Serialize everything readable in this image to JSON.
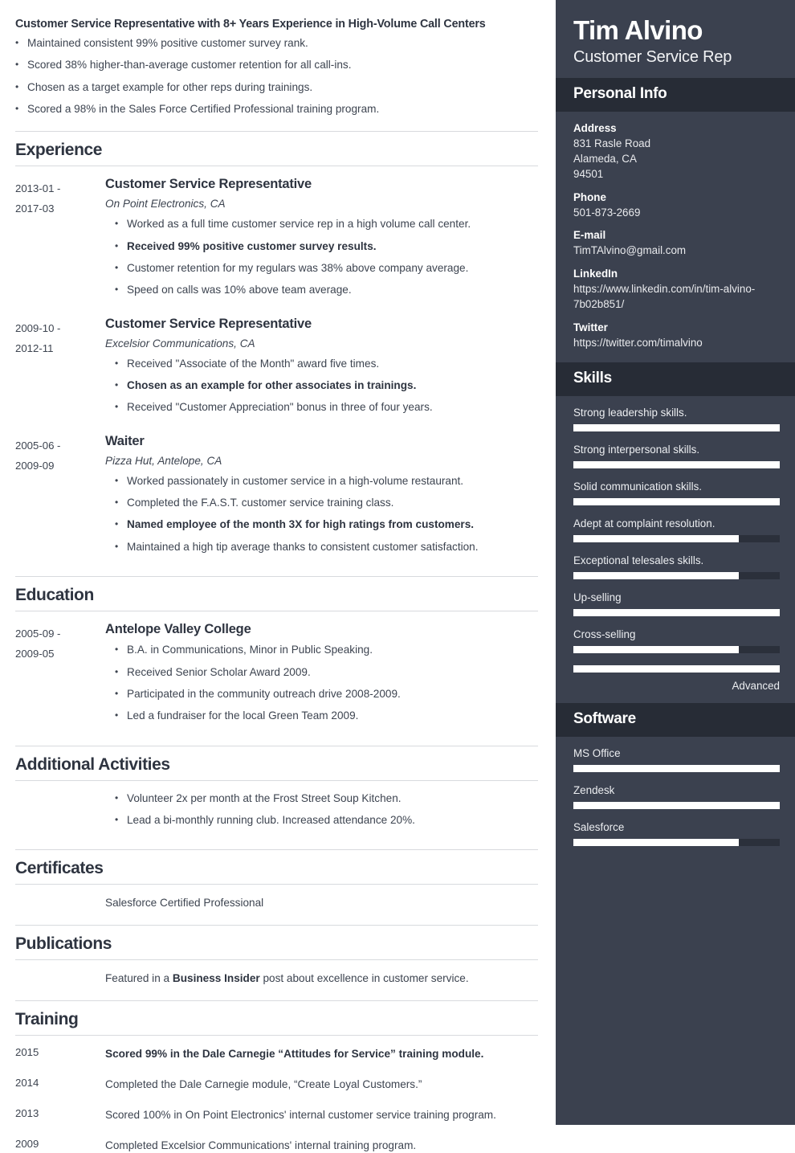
{
  "summary": {
    "title": "Customer Service Representative with 8+ Years Experience in High-Volume Call Centers",
    "bullets": [
      "Maintained consistent 99% positive customer survey rank.",
      "Scored 38% higher-than-average customer retention for all call-ins.",
      "Chosen as a target example for other reps during trainings.",
      "Scored a 98% in the Sales Force Certified Professional training program."
    ]
  },
  "sections": {
    "experience": "Experience",
    "education": "Education",
    "activities": "Additional Activities",
    "certificates": "Certificates",
    "publications": "Publications",
    "training": "Training"
  },
  "experience": [
    {
      "date_from": "2013-01 -",
      "date_to": "2017-03",
      "title": "Customer Service Representative",
      "company": "On Point Electronics, CA",
      "bullets": [
        {
          "text": "Worked as a full time customer service rep in a high volume call center.",
          "bold": false
        },
        {
          "text": "Received 99% positive customer survey results.",
          "bold": true
        },
        {
          "text": "Customer retention for my regulars was 38% above company average.",
          "bold": false
        },
        {
          "text": "Speed on calls was 10% above team average.",
          "bold": false
        }
      ]
    },
    {
      "date_from": "2009-10 -",
      "date_to": "2012-11",
      "title": "Customer Service Representative",
      "company": "Excelsior Communications, CA",
      "bullets": [
        {
          "text": "Received \"Associate of the Month\" award five times.",
          "bold": false
        },
        {
          "text": "Chosen as an example for other associates in trainings.",
          "bold": true
        },
        {
          "text": "Received \"Customer Appreciation\" bonus in three of four years.",
          "bold": false
        }
      ]
    },
    {
      "date_from": "2005-06 -",
      "date_to": "2009-09",
      "title": "Waiter",
      "company": "Pizza Hut, Antelope, CA",
      "bullets": [
        {
          "text": "Worked passionately in customer service in a high-volume restaurant.",
          "bold": false
        },
        {
          "text": "Completed the F.A.S.T. customer service training class.",
          "bold": false
        },
        {
          "text": "Named employee of the month 3X for high ratings from customers.",
          "bold": true
        },
        {
          "text": "Maintained a high tip average thanks to consistent customer satisfaction.",
          "bold": false
        }
      ]
    }
  ],
  "education": [
    {
      "date_from": "2005-09 -",
      "date_to": "2009-05",
      "title": "Antelope Valley College",
      "bullets": [
        {
          "text": "B.A. in Communications, Minor in Public Speaking.",
          "bold": false
        },
        {
          "text": "Received Senior Scholar Award 2009.",
          "bold": false
        },
        {
          "text": "Participated in the community outreach drive 2008-2009.",
          "bold": false
        },
        {
          "text": "Led a fundraiser for the local Green Team 2009.",
          "bold": false
        }
      ]
    }
  ],
  "activities": [
    {
      "text": "Volunteer 2x per month at the Frost Street Soup Kitchen.",
      "bold": false
    },
    {
      "text": "Lead a bi-monthly running club. Increased attendance 20%.",
      "bold": false
    }
  ],
  "certificates": [
    {
      "date": "",
      "text": "Salesforce Certified Professional"
    }
  ],
  "publications": [
    {
      "date": "",
      "text_before": "Featured in a ",
      "text_bold": "Business Insider",
      "text_after": " post about excellence in customer service."
    }
  ],
  "training": [
    {
      "date": "2015",
      "text": "Scored 99% in the Dale Carnegie “Attitudes for Service” training module.",
      "bold": true
    },
    {
      "date": "2014",
      "text": "Completed the Dale Carnegie module, “Create Loyal Customers.”",
      "bold": false
    },
    {
      "date": "2013",
      "text": "Scored 100% in On Point Electronics' internal customer service training program.",
      "bold": false
    },
    {
      "date": "2009",
      "text": "Completed Excelsior Communications' internal training program.",
      "bold": false
    }
  ],
  "sidebar": {
    "name": "Tim Alvino",
    "role": "Customer Service Rep",
    "personal_info_heading": "Personal Info",
    "skills_heading": "Skills",
    "software_heading": "Software",
    "contact": [
      {
        "label": "Address",
        "value": "831 Rasle Road\nAlameda, CA\n94501"
      },
      {
        "label": "Phone",
        "value": "501-873-2669"
      },
      {
        "label": "E-mail",
        "value": "TimTAlvino@gmail.com"
      },
      {
        "label": "LinkedIn",
        "value": "https://www.linkedin.com/in/tim-alvino-7b02b851/"
      },
      {
        "label": "Twitter",
        "value": "https://twitter.com/timalvino"
      }
    ],
    "skills": [
      {
        "label": "Strong leadership skills.",
        "level": 100
      },
      {
        "label": "Strong interpersonal skills.",
        "level": 100
      },
      {
        "label": "Solid communication skills.",
        "level": 100
      },
      {
        "label": "Adept at complaint resolution.",
        "level": 80
      },
      {
        "label": "Exceptional telesales skills.",
        "level": 80
      },
      {
        "label": "Up-selling",
        "level": 100
      },
      {
        "label": "Cross-selling",
        "level": 80
      },
      {
        "label": "",
        "level": 100,
        "caption": "Advanced"
      }
    ],
    "software": [
      {
        "label": "MS Office",
        "level": 100
      },
      {
        "label": "Zendesk",
        "level": 100
      },
      {
        "label": "Salesforce",
        "level": 80
      }
    ]
  },
  "colors": {
    "sidebar_bg": "#3b414f",
    "sidebar_head_bg": "#272c36",
    "bar_fill": "#ffffff",
    "bar_track": "#2b303b",
    "heading": "#2e3440"
  }
}
